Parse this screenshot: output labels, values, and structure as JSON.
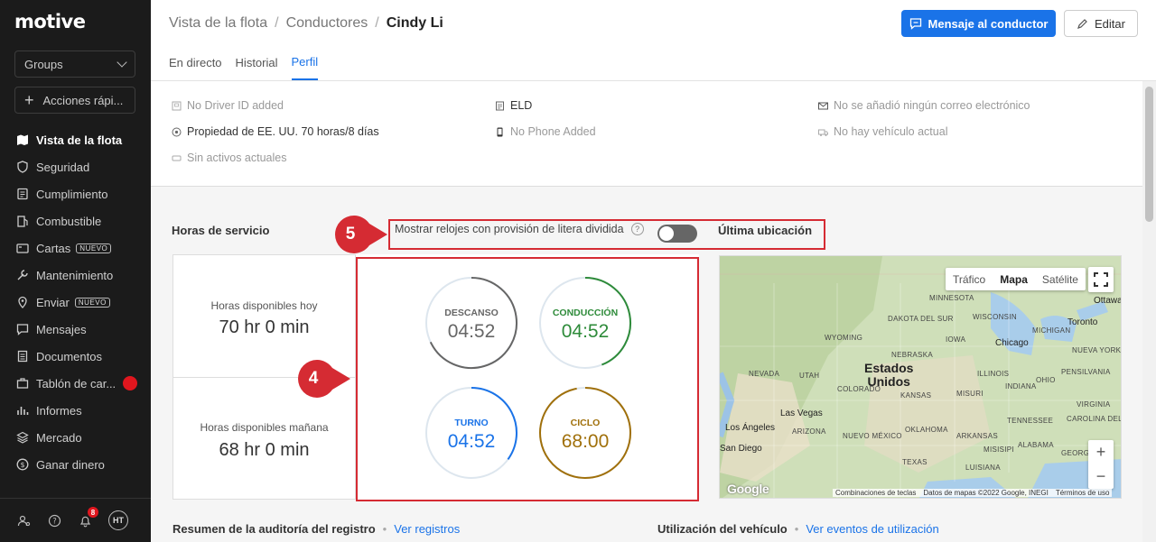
{
  "sidebar": {
    "logo": "motive",
    "groups_label": "Groups",
    "quick_actions_label": "Acciones rápi...",
    "items": [
      {
        "label": "Vista de la flota",
        "icon": "map-icon",
        "active": true
      },
      {
        "label": "Seguridad",
        "icon": "shield-icon"
      },
      {
        "label": "Cumplimiento",
        "icon": "clipboard-icon"
      },
      {
        "label": "Combustible",
        "icon": "fuel-icon"
      },
      {
        "label": "Cartas",
        "icon": "card-icon",
        "badge": "NUEVO"
      },
      {
        "label": "Mantenimiento",
        "icon": "wrench-icon"
      },
      {
        "label": "Enviar",
        "icon": "location-pin-icon",
        "badge": "NUEVO"
      },
      {
        "label": "Mensajes",
        "icon": "chat-icon"
      },
      {
        "label": "Documentos",
        "icon": "document-icon"
      },
      {
        "label": "Tablón de car...",
        "icon": "board-icon"
      },
      {
        "label": "Informes",
        "icon": "bar-chart-icon"
      },
      {
        "label": "Mercado",
        "icon": "layers-icon"
      },
      {
        "label": "Ganar dinero",
        "icon": "dollar-icon"
      }
    ],
    "notification_count": "8",
    "avatar_initials": "HT"
  },
  "header": {
    "breadcrumb": [
      "Vista de la flota",
      "Conductores",
      "Cindy Li"
    ],
    "message_button": "Mensaje al conductor",
    "edit_button": "Editar",
    "tabs": [
      "En directo",
      "Historial",
      "Perfil"
    ],
    "active_tab": "Perfil"
  },
  "profile": {
    "driver_id": "No Driver ID added",
    "ruleset": "Propiedad de EE. UU. 70 horas/8 días",
    "assets": "Sin activos actuales",
    "eld": "ELD",
    "phone": "No Phone Added",
    "email": "No se añadió ningún correo electrónico",
    "vehicle": "No hay vehículo actual"
  },
  "hos": {
    "title": "Horas de servicio",
    "split_toggle_label": "Mostrar relojes con provisión de litera dividida",
    "split_toggle_on": false,
    "last_location_title": "Última ubicación",
    "available_today_label": "Horas disponibles hoy",
    "available_today_value": "70 hr 0 min",
    "available_tomorrow_label": "Horas disponibles mañana",
    "available_tomorrow_value": "68 hr 0 min",
    "clocks": [
      {
        "name": "DESCANSO",
        "time": "04:52",
        "color": "#666666",
        "fraction": 0.68
      },
      {
        "name": "CONDUCCIÓN",
        "time": "04:52",
        "color": "#2e8b3a",
        "fraction": 0.44
      },
      {
        "name": "TURNO",
        "time": "04:52",
        "color": "#1a73e8",
        "fraction": 0.35
      },
      {
        "name": "CICLO",
        "time": "68:00",
        "color": "#a0700b",
        "fraction": 0.97
      }
    ]
  },
  "map": {
    "traffic_button": "Tráfico",
    "map_button": "Mapa",
    "satellite_button": "Satélite",
    "country": "Estados\nUnidos",
    "cities": [
      "Ottawa",
      "Toronto",
      "Chicago",
      "Las Vegas",
      "Los Ángeles",
      "San Diego"
    ],
    "regions": [
      "MINNESOTA",
      "WISCONSIN",
      "MICHIGAN",
      "DAKOTA DEL SUR",
      "IOWA",
      "WYOMING",
      "NEBRASKA",
      "NEVADA",
      "UTAH",
      "COLORADO",
      "KANSAS",
      "MISURI",
      "ARIZONA",
      "NUEVO MÉXICO",
      "OKLAHOMA",
      "TEXAS",
      "TENNESSEE",
      "CAROLINA DEL NORTE",
      "GEORGIA",
      "VIRGINIA",
      "NUEVA YORK",
      "PENSILVANIA",
      "OHIO",
      "INDIANA",
      "ILLINOIS",
      "ARKANSAS",
      "MISISIPI",
      "ALABAMA",
      "LUISIANA"
    ],
    "footer_shortcuts": "Combinaciones de teclas",
    "footer_data": "Datos de mapas ©2022 Google, INEGI",
    "footer_terms": "Términos de uso",
    "google_logo": "Google"
  },
  "annotations": {
    "callout_5": "5",
    "callout_4": "4",
    "color": "#d52b33"
  },
  "bottom": {
    "audit_title": "Resumen de la auditoría del registro",
    "audit_link": "Ver registros",
    "usage_title": "Utilización del vehículo",
    "usage_link": "Ver eventos de utilización"
  }
}
